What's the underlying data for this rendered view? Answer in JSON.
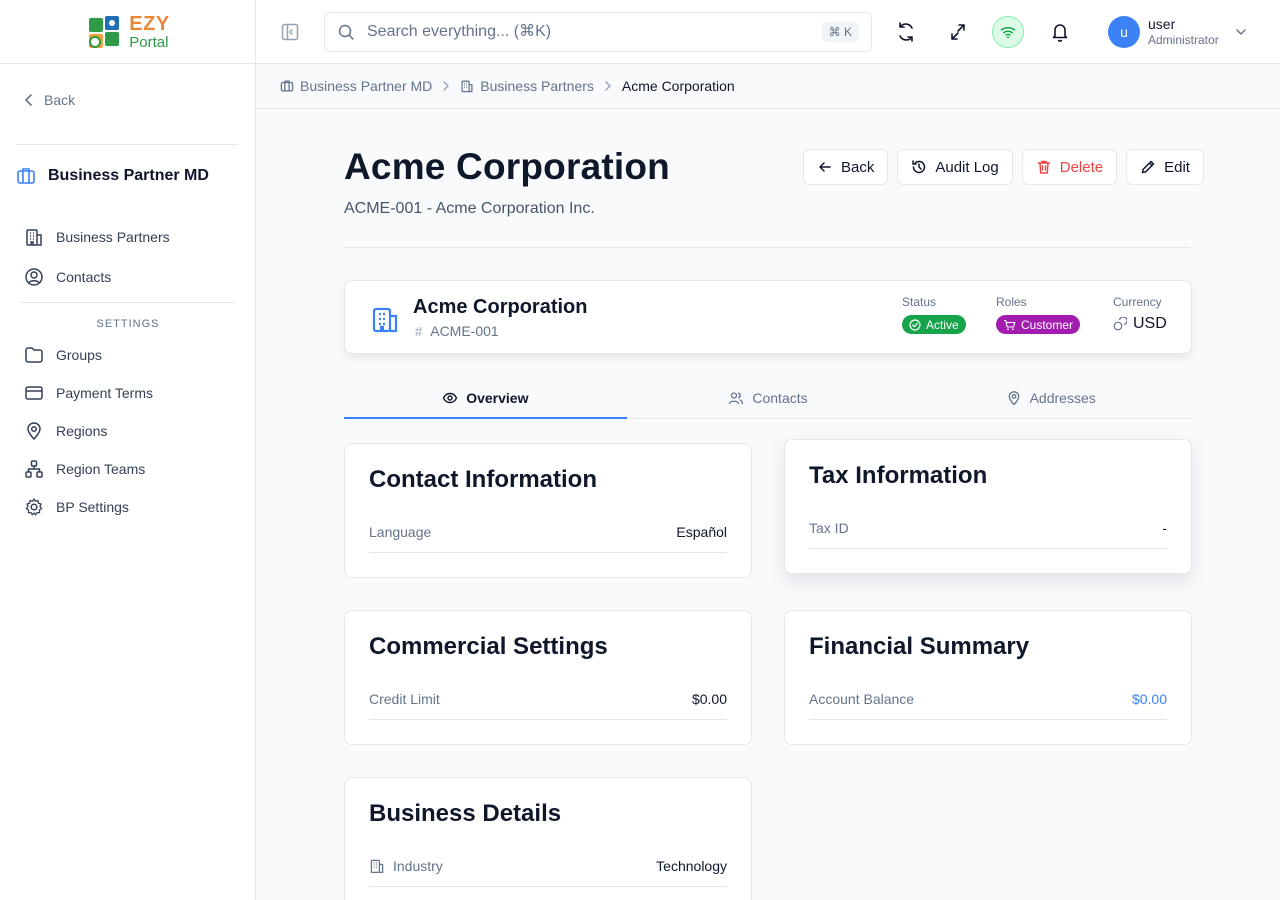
{
  "app": {
    "logo_top": "EZY",
    "logo_bottom": "Portal"
  },
  "sidebar": {
    "back_label": "Back",
    "module_title": "Business Partner MD",
    "items": [
      {
        "label": "Business Partners",
        "icon": "building-icon"
      },
      {
        "label": "Contacts",
        "icon": "user-circle-icon"
      }
    ],
    "settings_heading": "SETTINGS",
    "settings_items": [
      {
        "label": "Groups",
        "icon": "folder-icon"
      },
      {
        "label": "Payment Terms",
        "icon": "credit-card-icon"
      },
      {
        "label": "Regions",
        "icon": "map-pin-icon"
      },
      {
        "label": "Region Teams",
        "icon": "network-icon"
      },
      {
        "label": "BP Settings",
        "icon": "gear-icon"
      }
    ]
  },
  "header": {
    "search_placeholder": "Search everything... (⌘K)",
    "search_shortcut": "⌘ K",
    "user_initial": "u",
    "user_name": "user",
    "user_role": "Administrator"
  },
  "breadcrumb": {
    "items": [
      "Business Partner MD",
      "Business Partners"
    ],
    "current": "Acme Corporation"
  },
  "page": {
    "title": "Acme Corporation",
    "subtitle": "ACME-001 - Acme Corporation Inc.",
    "actions": {
      "back": "Back",
      "audit_log": "Audit Log",
      "delete": "Delete",
      "edit": "Edit"
    }
  },
  "summary": {
    "name": "Acme Corporation",
    "code": "ACME-001",
    "status_label": "Status",
    "status_value": "Active",
    "roles_label": "Roles",
    "roles_value": "Customer",
    "currency_label": "Currency",
    "currency_value": "USD"
  },
  "tabs": [
    {
      "label": "Overview",
      "icon": "eye-icon",
      "active": true
    },
    {
      "label": "Contacts",
      "icon": "users-icon",
      "active": false
    },
    {
      "label": "Addresses",
      "icon": "map-pin-icon",
      "active": false
    }
  ],
  "cards": {
    "contact": {
      "title": "Contact Information",
      "label": "Language",
      "value": "Español"
    },
    "tax": {
      "title": "Tax Information",
      "label": "Tax ID",
      "value": "-"
    },
    "commercial": {
      "title": "Commercial Settings",
      "label": "Credit Limit",
      "value": "$0.00"
    },
    "financial": {
      "title": "Financial Summary",
      "label": "Account Balance",
      "value": "$0.00"
    },
    "business": {
      "title": "Business Details",
      "label": "Industry",
      "value": "Technology"
    }
  },
  "colors": {
    "accent": "#3b82f6",
    "active_badge": "#16a34a",
    "customer_badge": "#a21caf",
    "delete": "#ef4444"
  }
}
